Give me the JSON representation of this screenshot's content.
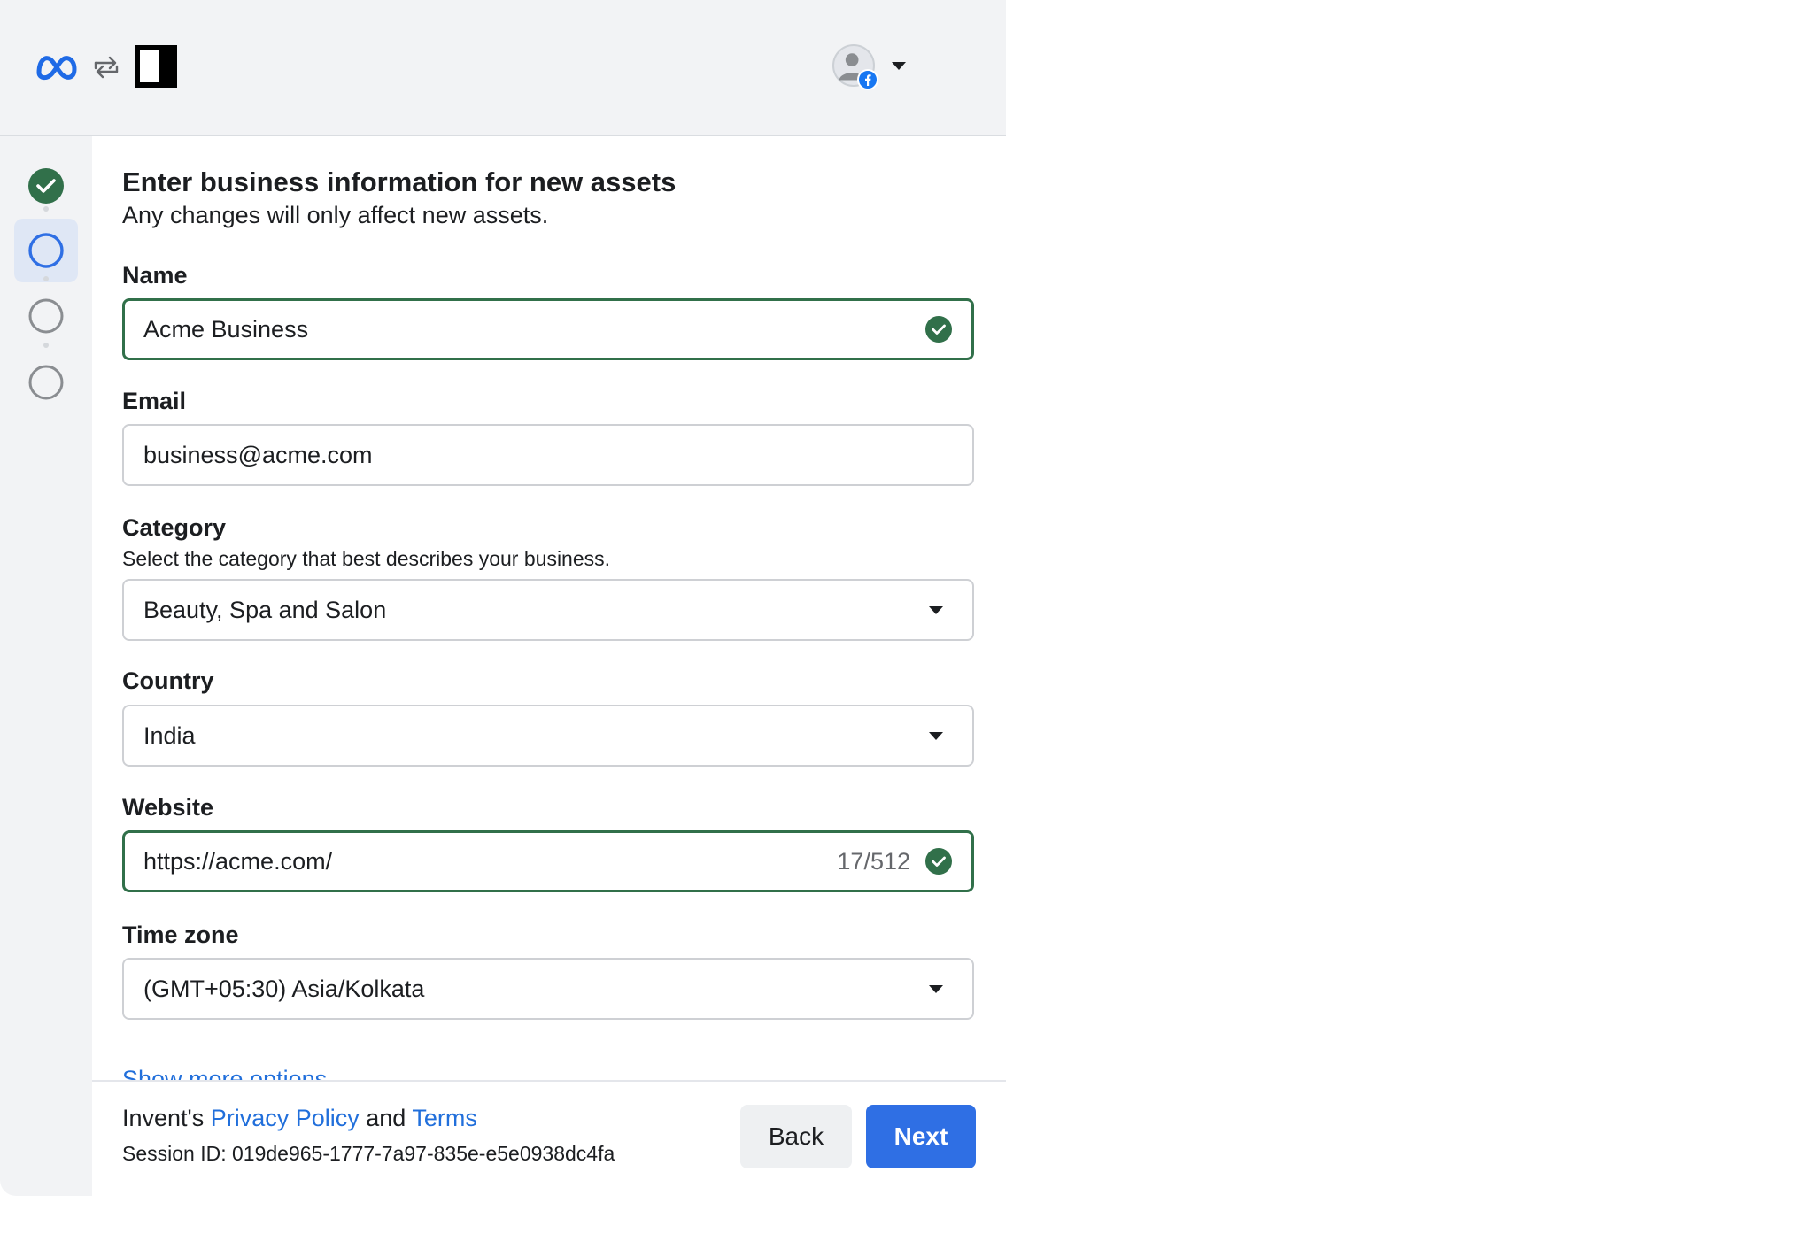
{
  "header": {
    "meta_logo": "meta-logo",
    "swap_icon": "swap-arrows-icon",
    "app_logo": "app-logo",
    "account_avatar": "avatar",
    "account_badge": "facebook-badge-icon"
  },
  "stepper": {
    "steps": [
      {
        "state": "complete"
      },
      {
        "state": "active"
      },
      {
        "state": "pending"
      },
      {
        "state": "pending"
      }
    ]
  },
  "form": {
    "title": "Enter business information for new assets",
    "subtitle": "Any changes will only affect new assets.",
    "name": {
      "label": "Name",
      "value": "Acme Business",
      "valid": true
    },
    "email": {
      "label": "Email",
      "value": "business@acme.com"
    },
    "category": {
      "label": "Category",
      "help": "Select the category that best describes your business.",
      "value": "Beauty, Spa and Salon"
    },
    "country": {
      "label": "Country",
      "value": "India"
    },
    "website": {
      "label": "Website",
      "value": "https://acme.com/",
      "counter": "17/512",
      "valid": true
    },
    "timezone": {
      "label": "Time zone",
      "value": "(GMT+05:30) Asia/Kolkata"
    },
    "show_more": "Show more options ⌄"
  },
  "footer": {
    "legal_prefix": "Invent's ",
    "privacy_link": "Privacy Policy",
    "legal_and": " and ",
    "terms_link": "Terms",
    "session": "Session ID: 019de965-1777-7a97-835e-e5e0938dc4fa",
    "back_label": "Back",
    "next_label": "Next"
  },
  "colors": {
    "accent": "#2f6fe4",
    "success": "#31704a",
    "link": "#216fdb",
    "rail_bg": "#f2f3f5"
  }
}
